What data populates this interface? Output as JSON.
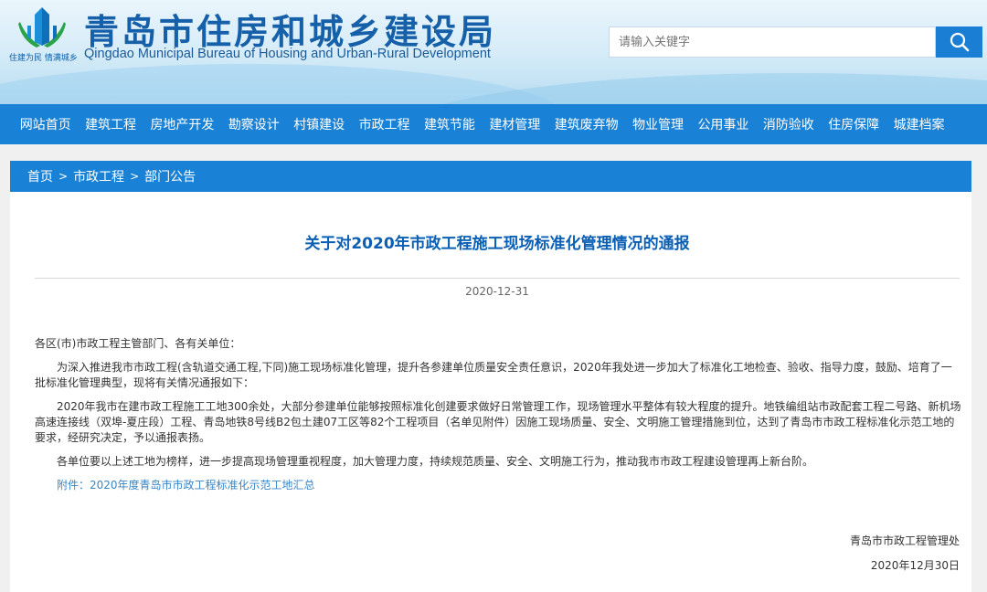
{
  "header": {
    "slogan": "住建为民 情满城乡",
    "title": "青岛市住房和城乡建设局",
    "subtitle": "Qingdao Municipal Bureau of Housing and Urban-Rural Development"
  },
  "search": {
    "placeholder": "请输入关键字"
  },
  "nav": {
    "items": [
      "网站首页",
      "建筑工程",
      "房地产开发",
      "勘察设计",
      "村镇建设",
      "市政工程",
      "建筑节能",
      "建材管理",
      "建筑废弃物",
      "物业管理",
      "公用事业",
      "消防验收",
      "住房保障",
      "城建档案"
    ]
  },
  "breadcrumb": {
    "home": "首页",
    "section": "市政工程",
    "current": "部门公告",
    "separator": ">"
  },
  "article": {
    "title": "关于对2020年市政工程施工现场标准化管理情况的通报",
    "date": "2020-12-31",
    "salutation": "各区(市)市政工程主管部门、各有关单位：",
    "p1": "为深入推进我市市政工程(含轨道交通工程,下同)施工现场标准化管理，提升各参建单位质量安全责任意识，2020年我处进一步加大了标准化工地检查、验收、指导力度，鼓励、培育了一批标准化管理典型，现将有关情况通报如下：",
    "p2": "2020年我市在建市政工程施工工地300余处，大部分参建单位能够按照标准化创建要求做好日常管理工作，现场管理水平整体有较大程度的提升。地铁编组站市政配套工程二号路、新机场高速连接线（双埠-夏庄段）工程、青岛地铁8号线B2包土建07工区等82个工程项目（名单见附件）因施工现场质量、安全、文明施工管理措施到位，达到了青岛市市政工程标准化示范工地的要求，经研究决定，予以通报表扬。",
    "p3": "各单位要以上述工地为榜样，进一步提高现场管理重视程度，加大管理力度，持续规范质量、安全、文明施工行为，推动我市市政工程建设管理再上新台阶。",
    "attachment": "附件：2020年度青岛市市政工程标准化示范工地汇总",
    "signature": "青岛市市政工程管理处",
    "sign_date": "2020年12月30日"
  },
  "colors": {
    "nav_bg": "#1a82d6",
    "title_blue": "#0a5fb4",
    "link_blue": "#3a86c6"
  }
}
